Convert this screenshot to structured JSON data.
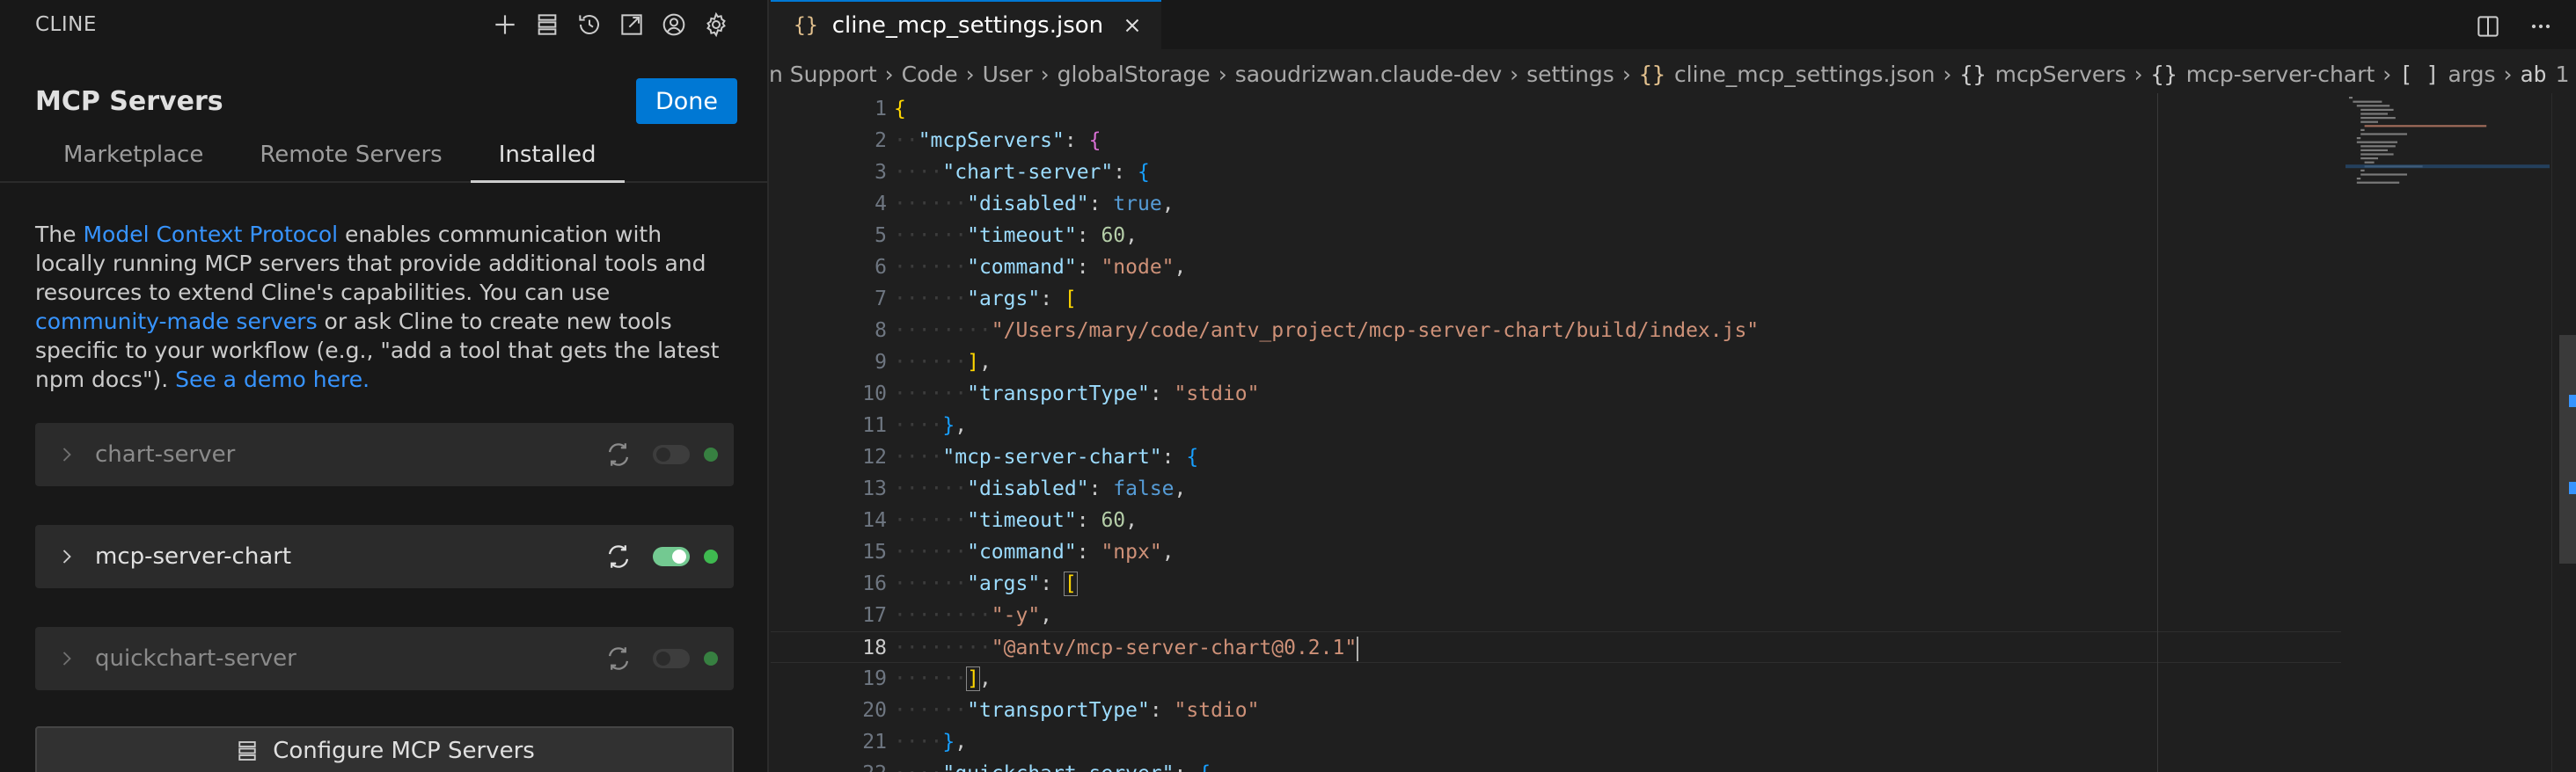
{
  "cline": {
    "brand": "CLINE",
    "toolbar_icons": [
      "plus-icon",
      "server-stack-icon",
      "history-icon",
      "popout-icon",
      "account-icon",
      "gear-icon"
    ],
    "title": "MCP Servers",
    "done_label": "Done",
    "tabs": [
      {
        "label": "Marketplace",
        "active": false
      },
      {
        "label": "Remote Servers",
        "active": false
      },
      {
        "label": "Installed",
        "active": true
      }
    ],
    "intro": {
      "p1": "The ",
      "link1": "Model Context Protocol",
      "p2": " enables communication with locally running MCP servers that provide additional tools and resources to extend Cline's capabilities. You can use ",
      "link2": "community-made servers",
      "p3": " or ask Cline to create new tools specific to your workflow (e.g., \"add a tool that gets the latest npm docs\"). ",
      "link3": "See a demo here."
    },
    "servers": [
      {
        "name": "chart-server",
        "enabled": false,
        "status_color": "#3fb950"
      },
      {
        "name": "mcp-server-chart",
        "enabled": true,
        "status_color": "#3fb950"
      },
      {
        "name": "quickchart-server",
        "enabled": false,
        "status_color": "#3fb950"
      }
    ],
    "configure_label": "Configure MCP Servers"
  },
  "editor": {
    "tab": {
      "icon": "{}",
      "filename": "cline_mcp_settings.json"
    },
    "actions": [
      "split-editor-icon",
      "more-icon"
    ],
    "breadcrumbs": [
      "n Support",
      "Code",
      "User",
      "globalStorage",
      "saoudrizwan.claude-dev",
      "settings",
      "cline_mcp_settings.json",
      "mcpServers",
      "mcp-server-chart",
      "args",
      "1"
    ],
    "cursor_line": 18,
    "lines": [
      "{",
      "  \"mcpServers\": {",
      "    \"chart-server\": {",
      "      \"disabled\": true,",
      "      \"timeout\": 60,",
      "      \"command\": \"node\",",
      "      \"args\": [",
      "        \"/Users/mary/code/antv_project/mcp-server-chart/build/index.js\"",
      "      ],",
      "      \"transportType\": \"stdio\"",
      "    },",
      "    \"mcp-server-chart\": {",
      "      \"disabled\": false,",
      "      \"timeout\": 60,",
      "      \"command\": \"npx\",",
      "      \"args\": [",
      "        \"-y\",",
      "        \"@antv/mcp-server-chart@0.2.1\"",
      "      ],",
      "      \"transportType\": \"stdio\"",
      "    },",
      "    \"quickchart-server\": {"
    ]
  },
  "colors": {
    "accent": "#0078d4",
    "string": "#ce9178",
    "key": "#9cdcfe",
    "number": "#b5cea8",
    "boolean": "#569cd6",
    "status_green": "#3fb950"
  }
}
